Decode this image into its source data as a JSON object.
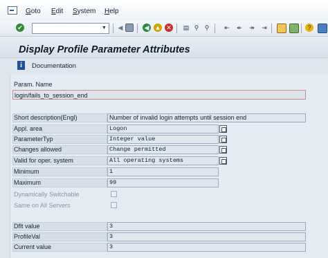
{
  "menu": {
    "items": [
      {
        "underline": "G",
        "rest": "oto"
      },
      {
        "underline": "E",
        "rest": "dit"
      },
      {
        "underline": "S",
        "rest": "ystem"
      },
      {
        "underline": "H",
        "rest": "elp"
      }
    ]
  },
  "toolbar": {
    "command_field_value": "",
    "icons": [
      "enter-icon",
      "save-icon",
      "back-icon",
      "exit-icon",
      "cancel-icon",
      "print-icon",
      "find-icon",
      "find-next-icon",
      "first-page-icon",
      "previous-page-icon",
      "next-page-icon",
      "last-page-icon",
      "new-session-icon",
      "shortcut-icon",
      "help-icon",
      "layout-icon"
    ]
  },
  "page": {
    "title": "Display Profile Parameter Attributes",
    "documentation_label": "Documentation"
  },
  "param": {
    "name_label": "Param. Name",
    "name_value": "login/fails_to_session_end"
  },
  "attributes": {
    "short_description_label": "Short description(Engl)",
    "short_description_value": "Number of invalid login attempts until session end",
    "appl_area_label": "Appl. area",
    "appl_area_value": "Logon",
    "parameter_type_label": "ParameterTyp",
    "parameter_type_value": "Integer value",
    "changes_allowed_label": "Changes allowed",
    "changes_allowed_value": "Change permitted",
    "valid_for_os_label": "Valid for oper. system",
    "valid_for_os_value": "All operating systems",
    "minimum_label": "Minimum",
    "minimum_value": "1",
    "maximum_label": "Maximum",
    "maximum_value": "99",
    "dynamically_switchable_label": "Dynamically Switchable",
    "dynamically_switchable_checked": false,
    "same_on_all_servers_label": "Same on All Servers",
    "same_on_all_servers_checked": false
  },
  "values": {
    "default_label": "Dflt value",
    "default_value": "3",
    "profile_label": "ProfileVal",
    "profile_value": "3",
    "current_label": "Current value",
    "current_value": "3"
  },
  "colors": {
    "background": "#dfe6ee",
    "field_border": "#9aabbf",
    "info_icon": "#1d4f9b"
  }
}
